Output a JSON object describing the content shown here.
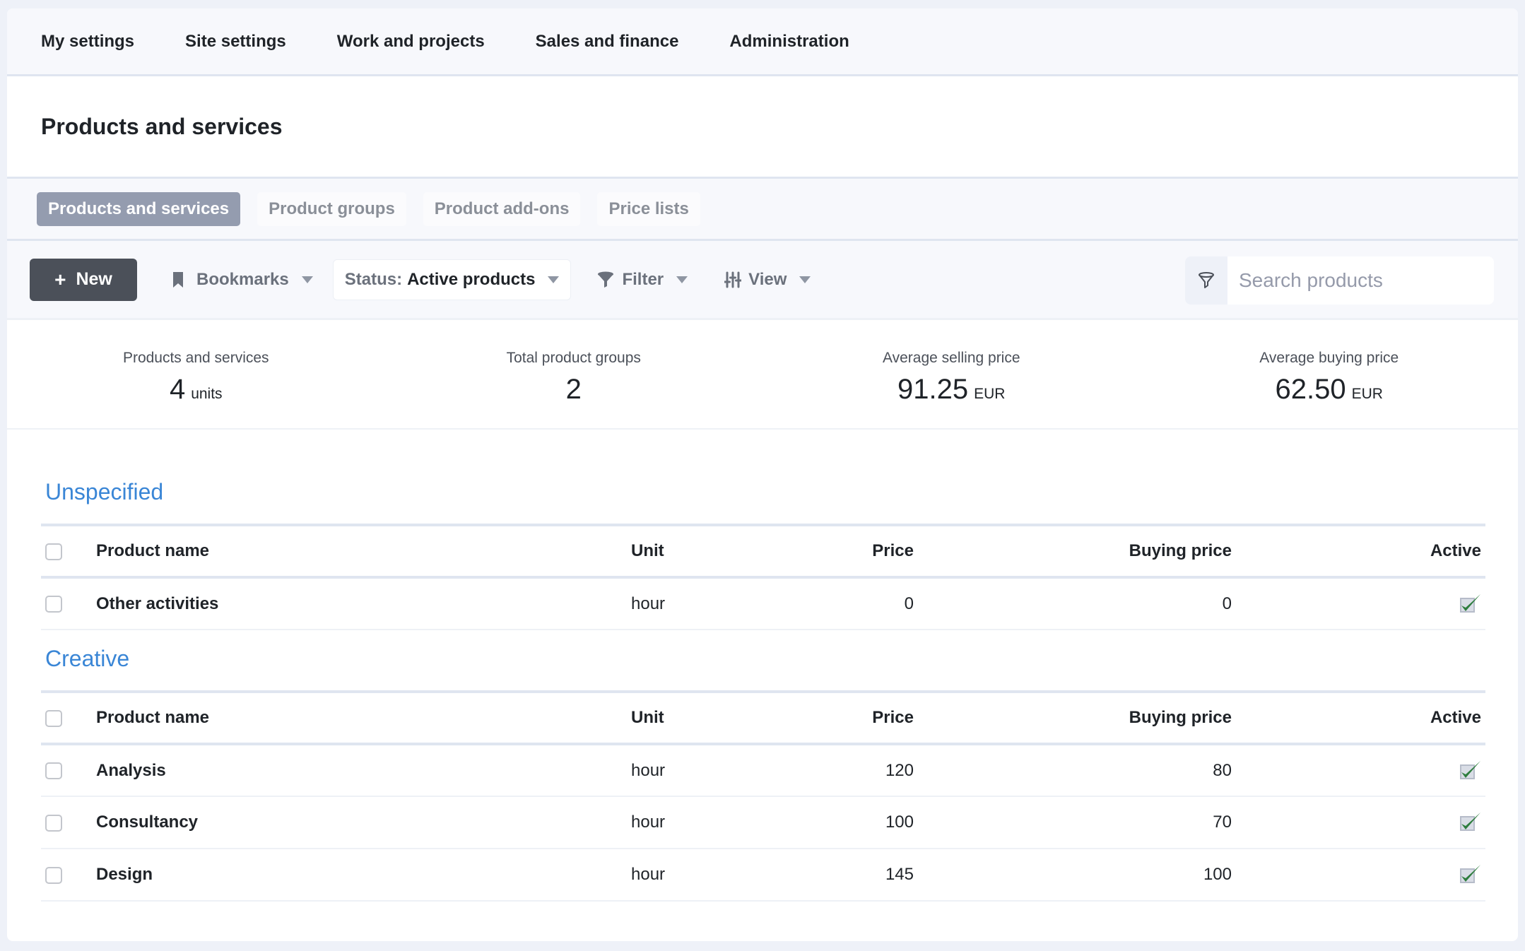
{
  "topnav": {
    "items": [
      {
        "label": "My settings"
      },
      {
        "label": "Site settings"
      },
      {
        "label": "Work and projects"
      },
      {
        "label": "Sales and finance"
      },
      {
        "label": "Administration"
      }
    ]
  },
  "page": {
    "title": "Products and services"
  },
  "tabs": [
    {
      "label": "Products and services",
      "active": true
    },
    {
      "label": "Product groups",
      "active": false
    },
    {
      "label": "Product add-ons",
      "active": false
    },
    {
      "label": "Price lists",
      "active": false
    }
  ],
  "toolbar": {
    "new_label": "New",
    "new_icon": "plus-icon",
    "bookmarks_label": "Bookmarks",
    "bookmarks_icon": "bookmark-icon",
    "status_prefix": "Status:",
    "status_value": "Active products",
    "filter_label": "Filter",
    "filter_icon": "funnel-icon",
    "view_label": "View",
    "view_icon": "sliders-icon",
    "search_placeholder": "Search products",
    "search_value": ""
  },
  "stats": [
    {
      "label": "Products and services",
      "value": "4",
      "unit": "units"
    },
    {
      "label": "Total product groups",
      "value": "2",
      "unit": ""
    },
    {
      "label": "Average selling price",
      "value": "91.25",
      "unit": "EUR"
    },
    {
      "label": "Average buying price",
      "value": "62.50",
      "unit": "EUR"
    }
  ],
  "columns": {
    "name": "Product name",
    "unit": "Unit",
    "price": "Price",
    "buying_price": "Buying price",
    "active": "Active"
  },
  "groups": [
    {
      "title": "Unspecified",
      "rows": [
        {
          "name": "Other activities",
          "unit": "hour",
          "price": "0",
          "buying_price": "0",
          "active": true
        }
      ]
    },
    {
      "title": "Creative",
      "rows": [
        {
          "name": "Analysis",
          "unit": "hour",
          "price": "120",
          "buying_price": "80",
          "active": true
        },
        {
          "name": "Consultancy",
          "unit": "hour",
          "price": "100",
          "buying_price": "70",
          "active": true
        },
        {
          "name": "Design",
          "unit": "hour",
          "price": "145",
          "buying_price": "100",
          "active": true
        }
      ]
    }
  ],
  "colors": {
    "accent_link": "#3a86d6",
    "primary_button": "#4b5059",
    "active_tab": "#949caf",
    "check_green": "#2e7d3e"
  }
}
